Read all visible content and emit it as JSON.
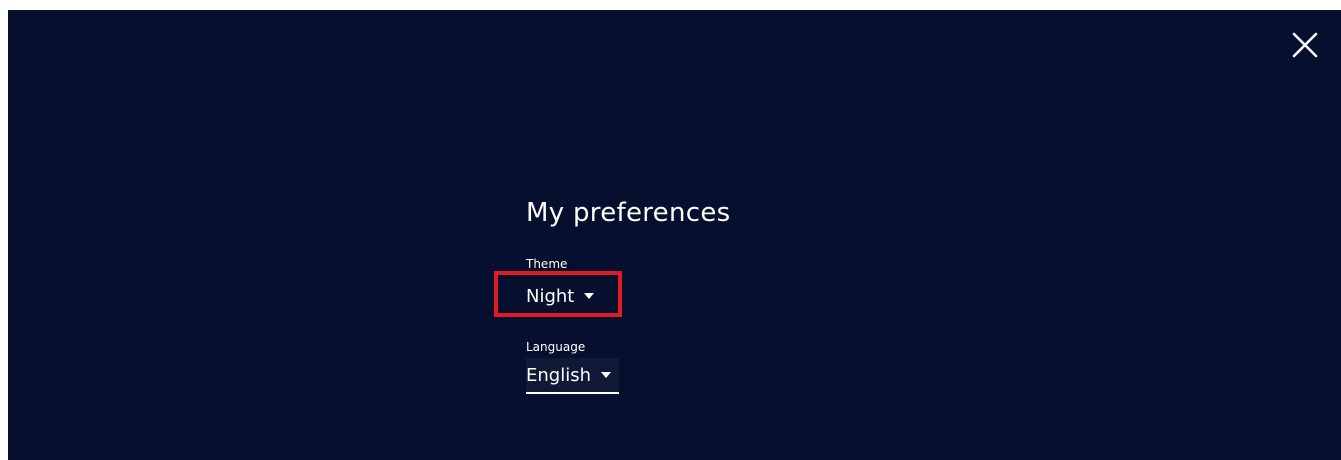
{
  "dialog": {
    "title": "My preferences",
    "close_icon": "close-icon"
  },
  "theme": {
    "label": "Theme",
    "value": "Night",
    "icon": "caret-down-icon"
  },
  "language": {
    "label": "Language",
    "value": "English",
    "icon": "caret-down-icon"
  },
  "colors": {
    "background": "#060f2e",
    "text": "#ffffff",
    "highlight": "#e01b24"
  }
}
